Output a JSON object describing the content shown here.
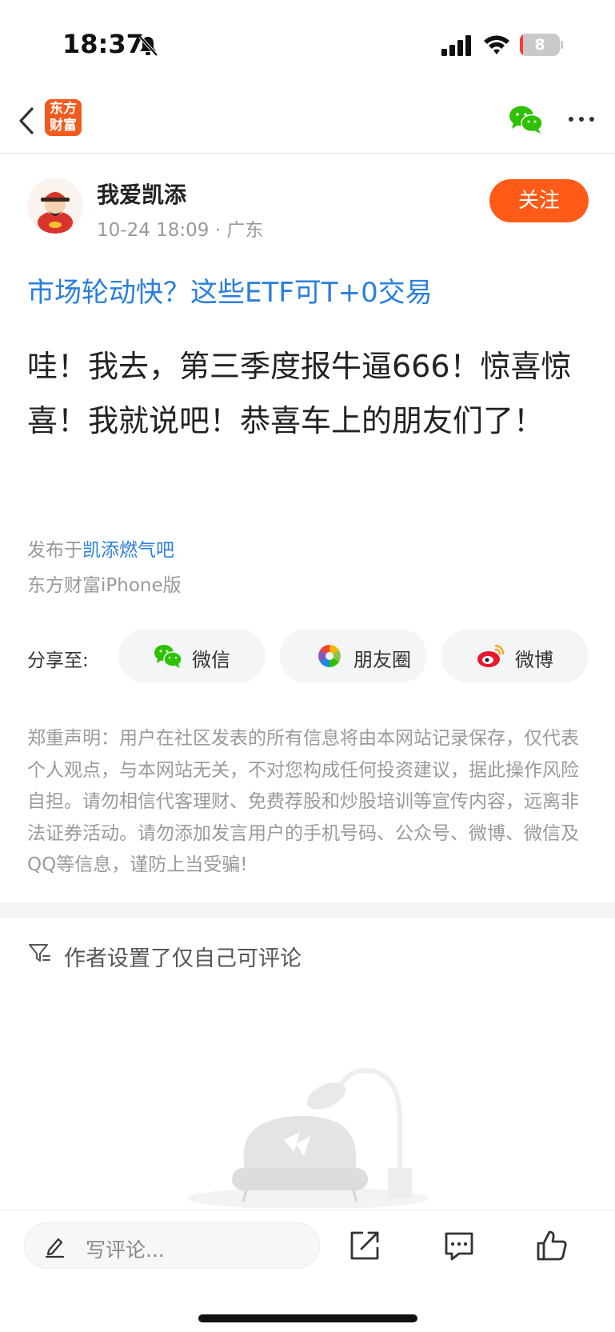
{
  "status_bar": {
    "time": "18:37",
    "battery_level": "8",
    "battery_fraction": 0.08
  },
  "nav": {
    "logo_line1": "东方",
    "logo_line2": "财富"
  },
  "post": {
    "author_name": "我爱凯添",
    "meta": "10-24 18:09 · 广东",
    "follow_label": "关注",
    "title": "市场轮动快？这些ETF可T+0交易",
    "body": "哇！我去，第三季度报牛逼666！惊喜惊喜！我就说吧！恭喜车上的朋友们了！",
    "published_prefix": "发布于",
    "forum_name": "凯添燃气吧",
    "client_source": "东方财富iPhone版"
  },
  "share": {
    "label": "分享至:",
    "targets": [
      {
        "label": "微信",
        "icon": "wechat-icon"
      },
      {
        "label": "朋友圈",
        "icon": "moments-icon"
      },
      {
        "label": "微博",
        "icon": "weibo-icon"
      }
    ]
  },
  "disclaimer": "郑重声明：用户在社区发表的所有信息将由本网站记录保存，仅代表个人观点，与本网站无关，不对您构成任何投资建议，据此操作风险自担。请勿相信代客理财、免费荐股和炒股培训等宣传内容，远离非法证券活动。请勿添加发言用户的手机号码、公众号、微博、微信及QQ等信息，谨防上当受骗!",
  "comments": {
    "notice": "作者设置了仅自己可评论"
  },
  "bottom_bar": {
    "input_placeholder": "写评论..."
  },
  "colors": {
    "accent_orange": "#ff5a17",
    "link_blue": "#2a7fdd",
    "wechat_green": "#2dc100"
  }
}
